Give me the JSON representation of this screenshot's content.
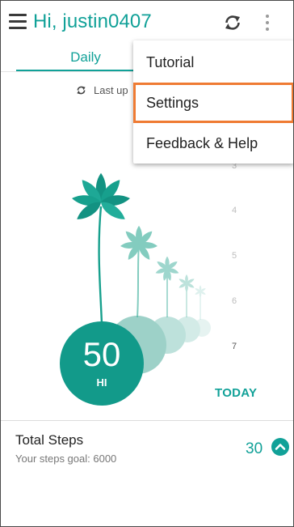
{
  "header": {
    "greeting": "Hi, justin0407",
    "menu_icon": "hamburger-menu-icon",
    "sync_icon": "sync-icon",
    "more_icon": "more-vert-icon"
  },
  "tabs": [
    {
      "label": "Daily",
      "selected": true
    }
  ],
  "last_updated": {
    "text": "Last up"
  },
  "dropdown_menu": {
    "items": [
      {
        "label": "Tutorial",
        "highlighted": false
      },
      {
        "label": "Settings",
        "highlighted": true
      },
      {
        "label": "Feedback & Help",
        "highlighted": false
      }
    ]
  },
  "activity_chart": {
    "day_labels": [
      "3",
      "4",
      "5",
      "6",
      "7"
    ],
    "current_value": "50",
    "current_level": "HI",
    "today_label": "TODAY"
  },
  "steps": {
    "title": "Total Steps",
    "goal_text": "Your steps goal: 6000",
    "value": "30",
    "expand_icon": "chevron-up-circle-icon"
  },
  "colors": {
    "accent": "#11a198",
    "highlight": "#ef7b33",
    "circle": "#129a8a"
  }
}
